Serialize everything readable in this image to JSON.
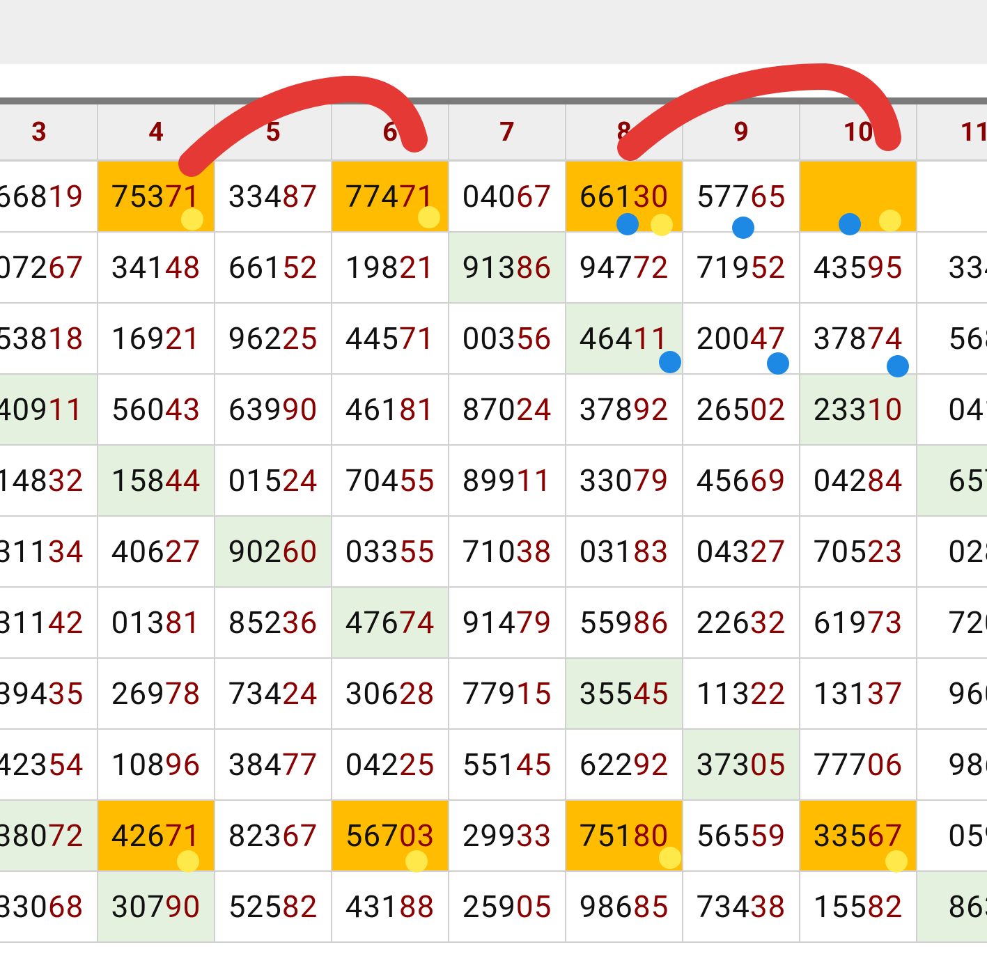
{
  "headers": [
    "3",
    "4",
    "5",
    "6",
    "7",
    "8",
    "9",
    "10",
    "11"
  ],
  "rows": [
    [
      "66819",
      "75371",
      "33487",
      "77471",
      "04067",
      "66130",
      "57765",
      "",
      ""
    ],
    [
      "07267",
      "34148",
      "66152",
      "19821",
      "91386",
      "94772",
      "71952",
      "43595",
      "334"
    ],
    [
      "53818",
      "16921",
      "96225",
      "44571",
      "00356",
      "46411",
      "20047",
      "37874",
      "568"
    ],
    [
      "40911",
      "56043",
      "63990",
      "46181",
      "87024",
      "37892",
      "26502",
      "23310",
      "041"
    ],
    [
      "14832",
      "15844",
      "01524",
      "70455",
      "89911",
      "33079",
      "45669",
      "04284",
      "657"
    ],
    [
      "31134",
      "40627",
      "90260",
      "03355",
      "71038",
      "03183",
      "04327",
      "70523",
      "028"
    ],
    [
      "31142",
      "01381",
      "85236",
      "47674",
      "91479",
      "55986",
      "22632",
      "61973",
      "720"
    ],
    [
      "39435",
      "26978",
      "73424",
      "30628",
      "77915",
      "35545",
      "11322",
      "13137",
      "960"
    ],
    [
      "42354",
      "10896",
      "38477",
      "04225",
      "55145",
      "62292",
      "37305",
      "77706",
      "986"
    ],
    [
      "38072",
      "42671",
      "82367",
      "56703",
      "29933",
      "75180",
      "56559",
      "33567",
      "059"
    ],
    [
      "33068",
      "30790",
      "52582",
      "43188",
      "25905",
      "98685",
      "73438",
      "15582",
      "863"
    ]
  ],
  "highlights": {
    "orange": [
      [
        0,
        1
      ],
      [
        0,
        3
      ],
      [
        0,
        5
      ],
      [
        0,
        7
      ],
      [
        9,
        1
      ],
      [
        9,
        3
      ],
      [
        9,
        5
      ],
      [
        9,
        7
      ]
    ],
    "green": [
      [
        1,
        4
      ],
      [
        2,
        5
      ],
      [
        3,
        0
      ],
      [
        3,
        7
      ],
      [
        4,
        1
      ],
      [
        4,
        8
      ],
      [
        5,
        2
      ],
      [
        6,
        3
      ],
      [
        7,
        5
      ],
      [
        8,
        6
      ],
      [
        9,
        0
      ],
      [
        10,
        1
      ],
      [
        10,
        8
      ]
    ]
  },
  "colors": {
    "header_text": "#8b0000",
    "prefix_text": "#111111",
    "suffix_text": "#8b0000",
    "orange": "#ffbc00",
    "green": "#e3f1de",
    "annotation_red": "#e53935",
    "dot_yellow": "#ffe94a",
    "dot_blue": "#1e88e5"
  }
}
